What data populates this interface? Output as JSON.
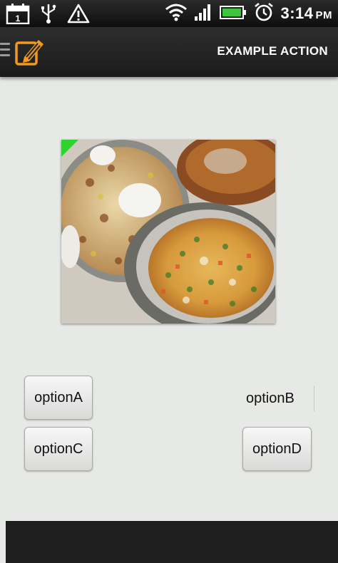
{
  "status_bar": {
    "calendar_day": "1",
    "time": "3:14",
    "ampm": "PM",
    "icons": [
      "calendar-icon",
      "usb-icon",
      "warning-icon",
      "wifi-icon",
      "signal-icon",
      "battery-icon",
      "alarm-icon"
    ]
  },
  "action_bar": {
    "action_label": "EXAMPLE ACTION",
    "logo_icon": "pencil-icon"
  },
  "options": {
    "a": "optionA",
    "b": "optionB",
    "c": "optionC",
    "d": "optionD"
  },
  "colors": {
    "background": "#e7e9e6",
    "logo_orange": "#f39a1e",
    "corner_green": "#2fd32f"
  }
}
